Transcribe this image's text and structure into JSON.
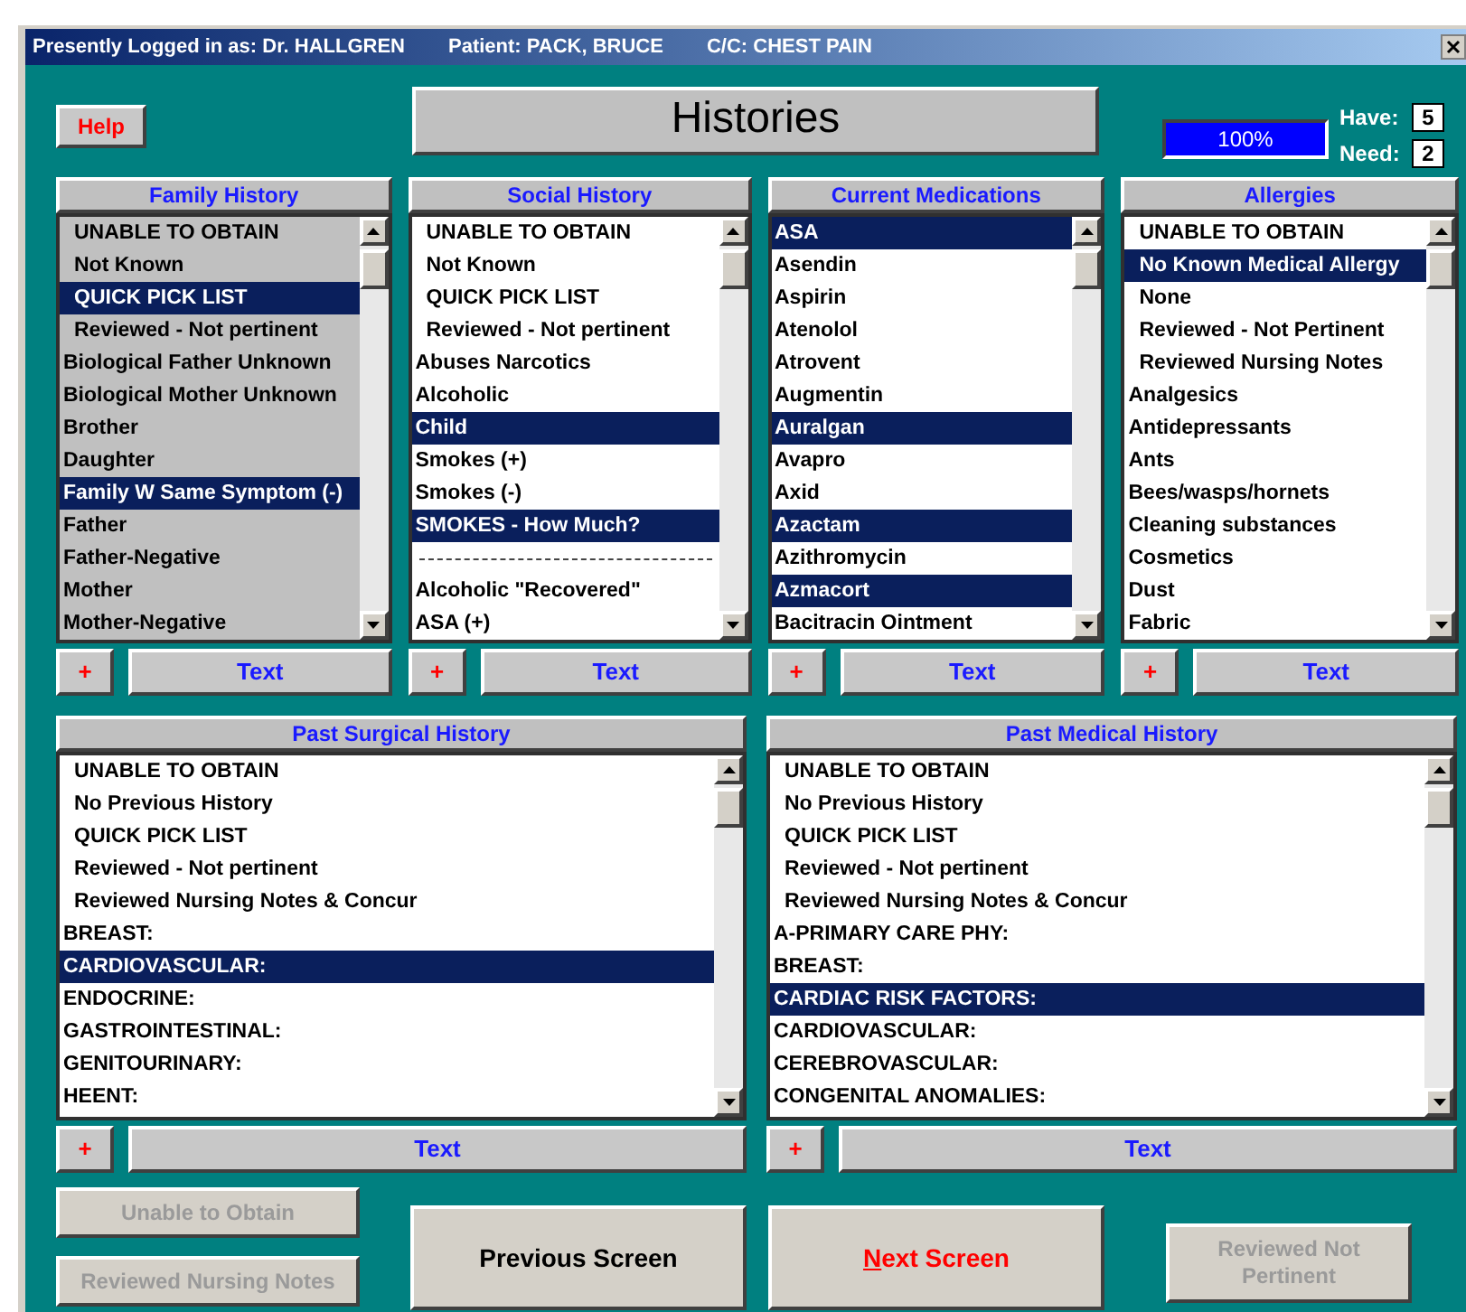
{
  "title_bar": {
    "user": "Presently Logged in as:  Dr. HALLGREN",
    "patient": "Patient: PACK, BRUCE",
    "complaint": "C/C: CHEST PAIN"
  },
  "help_button": "Help",
  "heading": "Histories",
  "progress": {
    "level": 1,
    "reading": "100%"
  },
  "counts": [
    {
      "label": "Have:",
      "value": "5"
    },
    {
      "label": "Need:",
      "value": "2"
    }
  ],
  "top_lists": [
    {
      "title": "Family History",
      "disabled": true,
      "add": "+",
      "text_button": "Text",
      "items": [
        {
          "kind": "special",
          "text": "UNABLE TO OBTAIN",
          "selected": false
        },
        {
          "kind": "special",
          "text": "Not Known",
          "selected": false
        },
        {
          "kind": "special",
          "text": "QUICK PICK LIST",
          "selected": true
        },
        {
          "kind": "special",
          "text": "Reviewed - Not pertinent",
          "selected": false
        },
        {
          "kind": "item",
          "text": "Biological Father Unknown",
          "selected": false
        },
        {
          "kind": "item",
          "text": "Biological Mother Unknown",
          "selected": false
        },
        {
          "kind": "item",
          "text": "Brother",
          "selected": false
        },
        {
          "kind": "item",
          "text": "Daughter",
          "selected": false
        },
        {
          "kind": "item",
          "text": "Family W Same Symptom (-)",
          "selected": true
        },
        {
          "kind": "item",
          "text": "Father",
          "selected": false
        },
        {
          "kind": "item",
          "text": "Father-Negative",
          "selected": false
        },
        {
          "kind": "item",
          "text": "Mother",
          "selected": false
        },
        {
          "kind": "item",
          "text": "Mother-Negative",
          "selected": false
        }
      ]
    },
    {
      "title": "Social History",
      "disabled": false,
      "add": "+",
      "text_button": "Text",
      "items": [
        {
          "kind": "special",
          "text": "UNABLE TO OBTAIN",
          "selected": false
        },
        {
          "kind": "special",
          "text": "Not Known",
          "selected": false
        },
        {
          "kind": "special",
          "text": "QUICK PICK LIST",
          "selected": false
        },
        {
          "kind": "special",
          "text": "Reviewed - Not pertinent",
          "selected": false
        },
        {
          "kind": "item",
          "text": "Abuses Narcotics",
          "selected": false
        },
        {
          "kind": "item",
          "text": "Alcoholic",
          "selected": false
        },
        {
          "kind": "item",
          "text": "Child",
          "selected": true
        },
        {
          "kind": "item",
          "text": "Smokes (+)",
          "selected": false
        },
        {
          "kind": "item",
          "text": "Smokes (-)",
          "selected": false
        },
        {
          "kind": "item",
          "text": "SMOKES - How Much?",
          "selected": true
        },
        {
          "kind": "separator"
        },
        {
          "kind": "item",
          "text": "Alcoholic \"Recovered\"",
          "selected": false
        },
        {
          "kind": "item",
          "text": "ASA (+)",
          "selected": false
        }
      ]
    },
    {
      "title": "Current Medications",
      "disabled": false,
      "add": "+",
      "text_button": "Text",
      "items": [
        {
          "kind": "item",
          "text": "ASA",
          "selected": true
        },
        {
          "kind": "item",
          "text": "Asendin",
          "selected": false
        },
        {
          "kind": "item",
          "text": "Aspirin",
          "selected": false
        },
        {
          "kind": "item",
          "text": "Atenolol",
          "selected": false
        },
        {
          "kind": "item",
          "text": "Atrovent",
          "selected": false
        },
        {
          "kind": "item",
          "text": "Augmentin",
          "selected": false
        },
        {
          "kind": "item",
          "text": "Auralgan",
          "selected": true
        },
        {
          "kind": "item",
          "text": "Avapro",
          "selected": false
        },
        {
          "kind": "item",
          "text": "Axid",
          "selected": false
        },
        {
          "kind": "item",
          "text": "Azactam",
          "selected": true
        },
        {
          "kind": "item",
          "text": "Azithromycin",
          "selected": false
        },
        {
          "kind": "item",
          "text": "Azmacort",
          "selected": true
        },
        {
          "kind": "item",
          "text": "Bacitracin Ointment",
          "selected": false
        }
      ]
    },
    {
      "title": "Allergies",
      "disabled": false,
      "add": "+",
      "text_button": "Text",
      "items": [
        {
          "kind": "special",
          "text": "UNABLE TO OBTAIN",
          "selected": false
        },
        {
          "kind": "special",
          "text": "No Known Medical Allergy",
          "selected": true
        },
        {
          "kind": "special",
          "text": "None",
          "selected": false
        },
        {
          "kind": "special",
          "text": "Reviewed - Not Pertinent",
          "selected": false
        },
        {
          "kind": "special",
          "text": "Reviewed Nursing Notes",
          "selected": false
        },
        {
          "kind": "item",
          "text": "Analgesics",
          "selected": false
        },
        {
          "kind": "item",
          "text": "Antidepressants",
          "selected": false
        },
        {
          "kind": "item",
          "text": "Ants",
          "selected": false
        },
        {
          "kind": "item",
          "text": "Bees/wasps/hornets",
          "selected": false
        },
        {
          "kind": "item",
          "text": "Cleaning substances",
          "selected": false
        },
        {
          "kind": "item",
          "text": "Cosmetics",
          "selected": false
        },
        {
          "kind": "item",
          "text": "Dust",
          "selected": false
        },
        {
          "kind": "item",
          "text": "Fabric",
          "selected": false
        }
      ]
    }
  ],
  "bottom_lists": [
    {
      "title": "Past Surgical History",
      "disabled": false,
      "add": "+",
      "text_button": "Text",
      "items": [
        {
          "kind": "special",
          "text": "UNABLE TO OBTAIN",
          "selected": false
        },
        {
          "kind": "special",
          "text": "No Previous History",
          "selected": false
        },
        {
          "kind": "special",
          "text": "QUICK PICK LIST",
          "selected": false
        },
        {
          "kind": "special",
          "text": "Reviewed - Not pertinent",
          "selected": false
        },
        {
          "kind": "special",
          "text": "Reviewed Nursing Notes & Concur",
          "selected": false
        },
        {
          "kind": "item",
          "text": "BREAST:",
          "selected": false
        },
        {
          "kind": "item",
          "text": "CARDIOVASCULAR:",
          "selected": true
        },
        {
          "kind": "item",
          "text": "ENDOCRINE:",
          "selected": false
        },
        {
          "kind": "item",
          "text": "GASTROINTESTINAL:",
          "selected": false
        },
        {
          "kind": "item",
          "text": "GENITOURINARY:",
          "selected": false
        },
        {
          "kind": "item",
          "text": "HEENT:",
          "selected": false
        }
      ]
    },
    {
      "title": "Past Medical History",
      "disabled": false,
      "add": "+",
      "text_button": "Text",
      "items": [
        {
          "kind": "special",
          "text": "UNABLE TO OBTAIN",
          "selected": false
        },
        {
          "kind": "special",
          "text": "No Previous History",
          "selected": false
        },
        {
          "kind": "special",
          "text": "QUICK PICK LIST",
          "selected": false
        },
        {
          "kind": "special",
          "text": "Reviewed - Not pertinent",
          "selected": false
        },
        {
          "kind": "special",
          "text": "Reviewed Nursing Notes & Concur",
          "selected": false
        },
        {
          "kind": "item",
          "text": "A-PRIMARY CARE PHY:",
          "selected": false
        },
        {
          "kind": "item",
          "text": "BREAST:",
          "selected": false
        },
        {
          "kind": "item",
          "text": "CARDIAC RISK FACTORS:",
          "selected": true
        },
        {
          "kind": "item",
          "text": "CARDIOVASCULAR:",
          "selected": false
        },
        {
          "kind": "item",
          "text": "CEREBROVASCULAR:",
          "selected": false
        },
        {
          "kind": "item",
          "text": "CONGENITAL ANOMALIES:",
          "selected": false
        }
      ]
    }
  ],
  "footer_buttons": [
    {
      "label": "Unable to Obtain",
      "disabled": true
    },
    {
      "label": "Reviewed Nursing Notes",
      "disabled": true
    }
  ],
  "previous_button": {
    "label": "Previous Screen",
    "kind": "normal",
    "underline_first": false
  },
  "next_button": {
    "label": "Next Screen",
    "kind": "alert",
    "underline_first": true
  },
  "reviewed_button": {
    "label": "Reviewed Not Pertinent",
    "disabled": true
  }
}
